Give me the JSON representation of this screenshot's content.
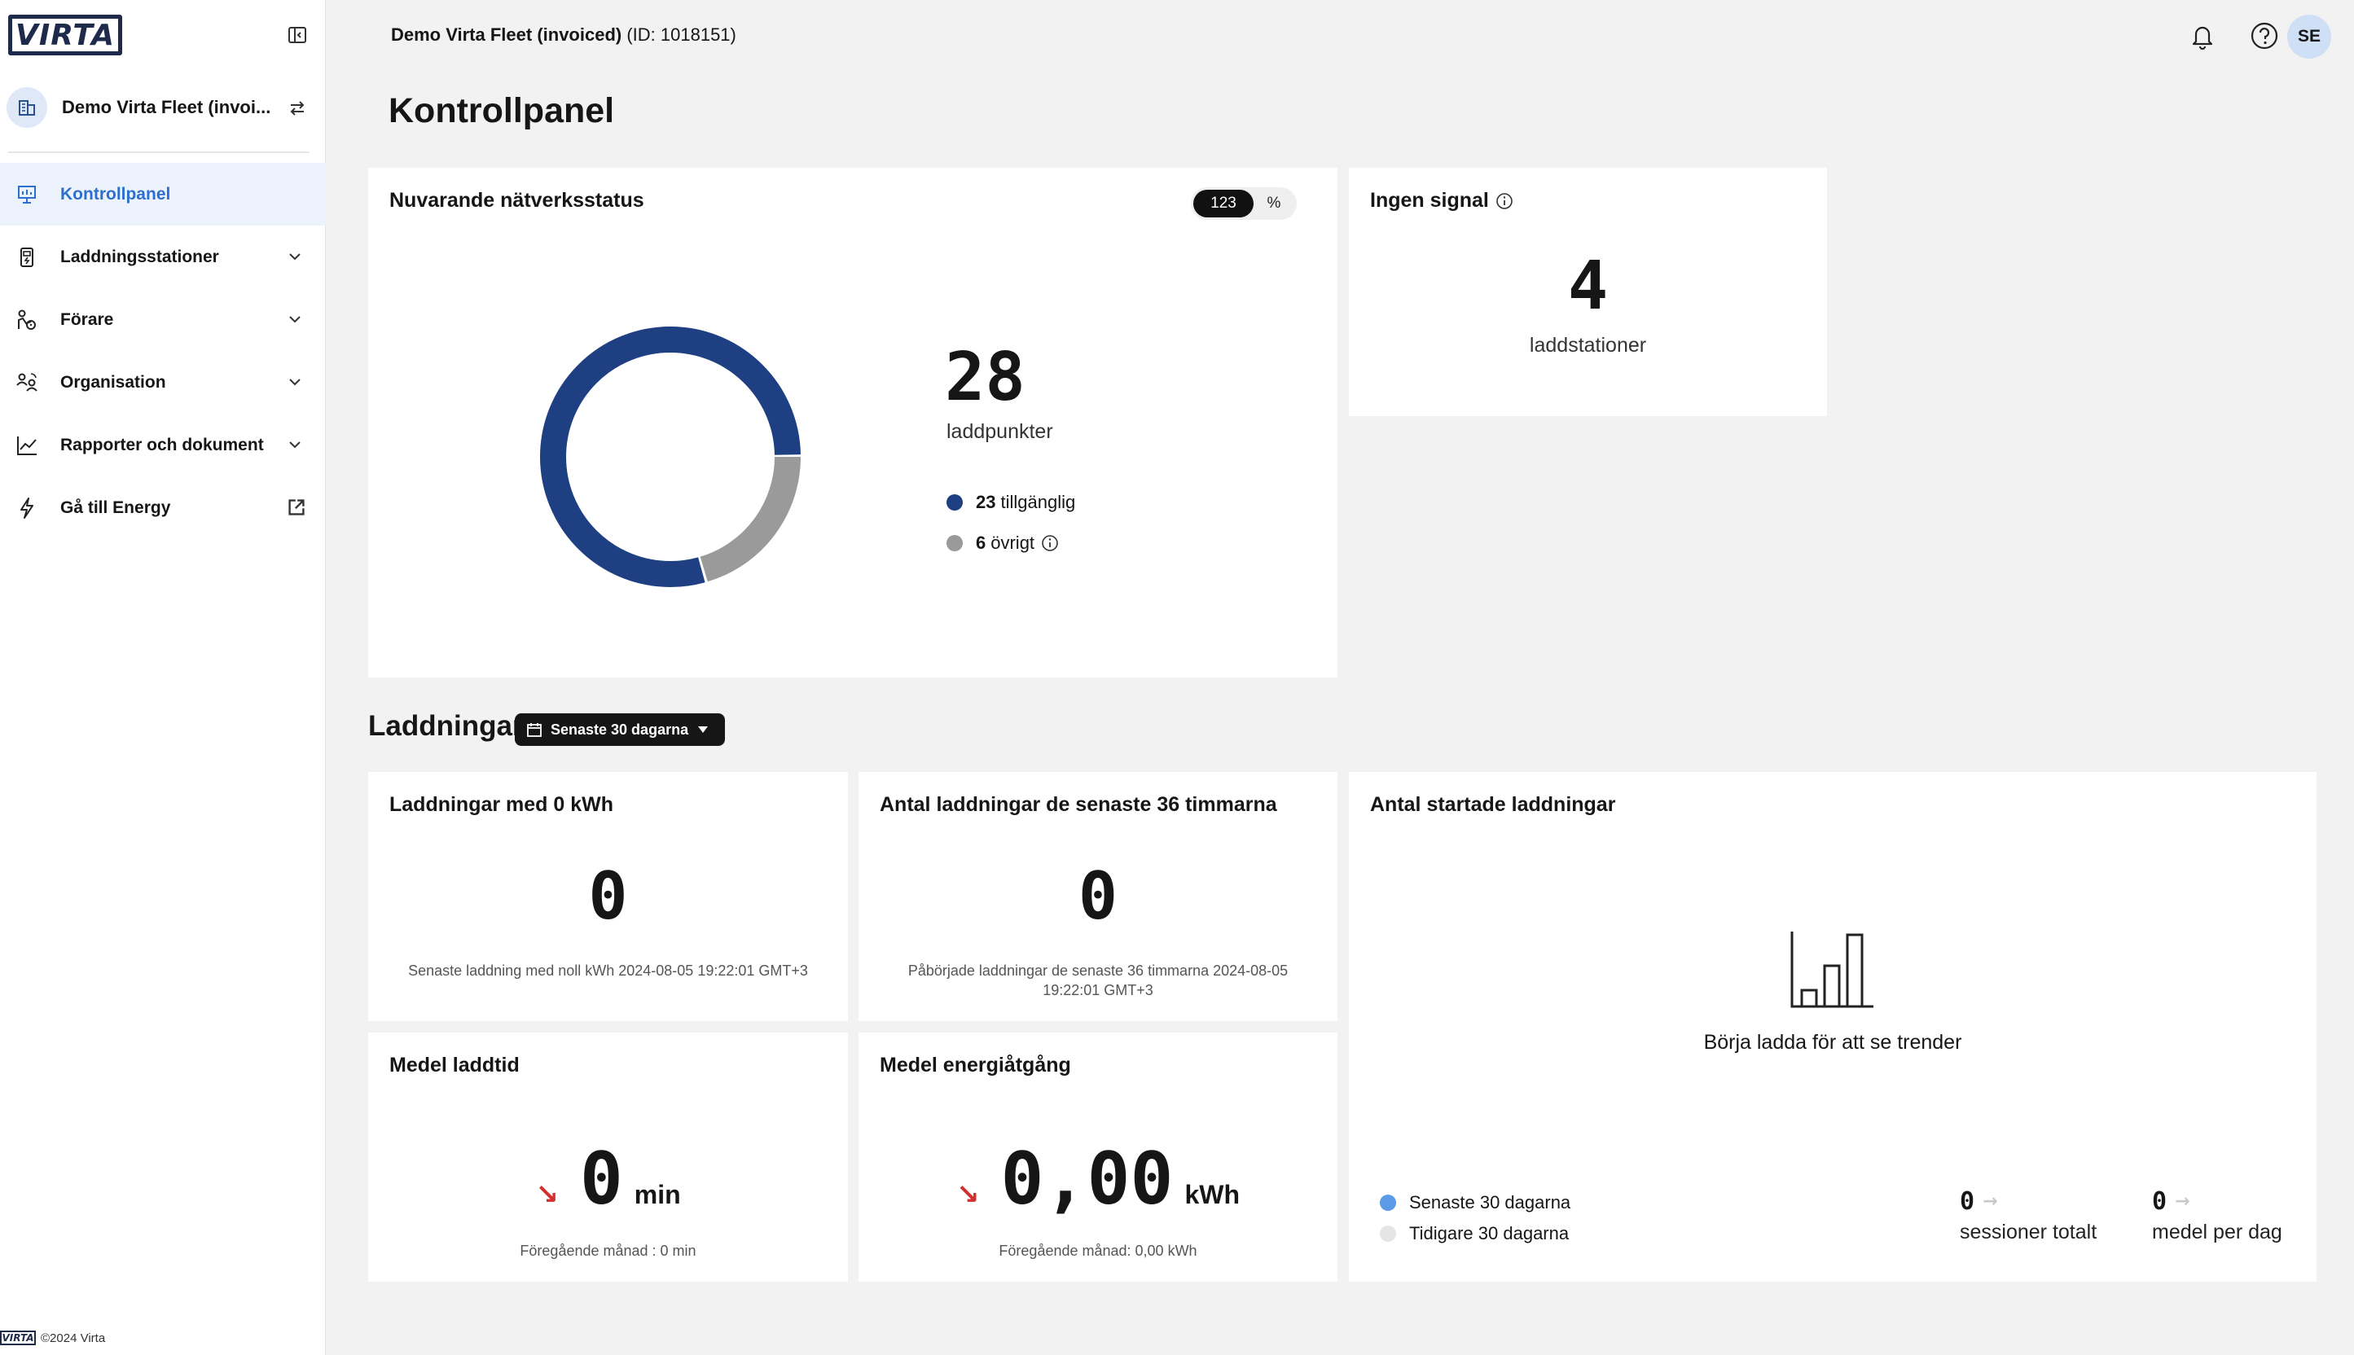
{
  "brand": {
    "logo_text": "VIRTA",
    "accent": "#2c6fce",
    "donut_primary": "#1f3f83",
    "donut_secondary": "#9a9a9a"
  },
  "sidebar": {
    "org_name": "Demo Virta Fleet (invoi...",
    "items": [
      {
        "label": "Kontrollpanel",
        "icon": "dashboard-icon",
        "active": true
      },
      {
        "label": "Laddningsstationer",
        "icon": "charger-icon"
      },
      {
        "label": "Förare",
        "icon": "driver-icon"
      },
      {
        "label": "Organisation",
        "icon": "organisation-icon"
      },
      {
        "label": "Rapporter och dokument",
        "icon": "report-chart-icon"
      },
      {
        "label": "Gå till Energy",
        "icon": "lightning-icon",
        "external": true
      }
    ],
    "footer": "©2024 Virta",
    "footer_logo": "VIRTA"
  },
  "header": {
    "fleet_name": "Demo Virta Fleet (invoiced)",
    "fleet_id": "(ID: 1018151)",
    "user_initials": "SE"
  },
  "page_title": "Kontrollpanel",
  "network": {
    "title": "Nuvarande nätverksstatus",
    "toggle": {
      "count": "123",
      "percent": "%"
    },
    "total": "28",
    "total_label": "laddpunkter",
    "available_value": "23",
    "available_label": "tillgänglig",
    "other_value": "6",
    "other_label": "övrigt",
    "available_fraction": 0.793,
    "other_fraction": 0.207
  },
  "no_signal": {
    "title": "Ingen signal",
    "value": "4",
    "label": "laddstationer"
  },
  "charging": {
    "section_title": "Laddningar",
    "period": "Senaste 30 dagarna",
    "zero_kwh": {
      "title": "Laddningar med 0 kWh",
      "value": "0",
      "note": "Senaste laddning med noll kWh 2024-08-05 19:22:01 GMT+3"
    },
    "last_36h": {
      "title": "Antal laddningar de senaste 36 timmarna",
      "value": "0",
      "note": "Påbörjade laddningar de senaste 36 timmarna 2024-08-05 19:22:01 GMT+3"
    },
    "avg_time": {
      "title": "Medel laddtid",
      "value": "0",
      "unit": "min",
      "note": "Föregående månad : 0 min"
    },
    "avg_energy": {
      "title": "Medel energiåtgång",
      "value": "0,00",
      "unit": "kWh",
      "note": "Föregående månad: 0,00 kWh"
    },
    "started": {
      "title": "Antal startade laddningar",
      "empty_text": "Börja ladda för att se trender",
      "legend_current": "Senaste 30 dagarna",
      "legend_previous": "Tidigare 30 dagarna",
      "current_color": "#5b9be8",
      "previous_color": "#e5e5e5",
      "sessions_value": "0",
      "sessions_label": "sessioner totalt",
      "per_day_value": "0",
      "per_day_label": "medel per dag"
    }
  }
}
